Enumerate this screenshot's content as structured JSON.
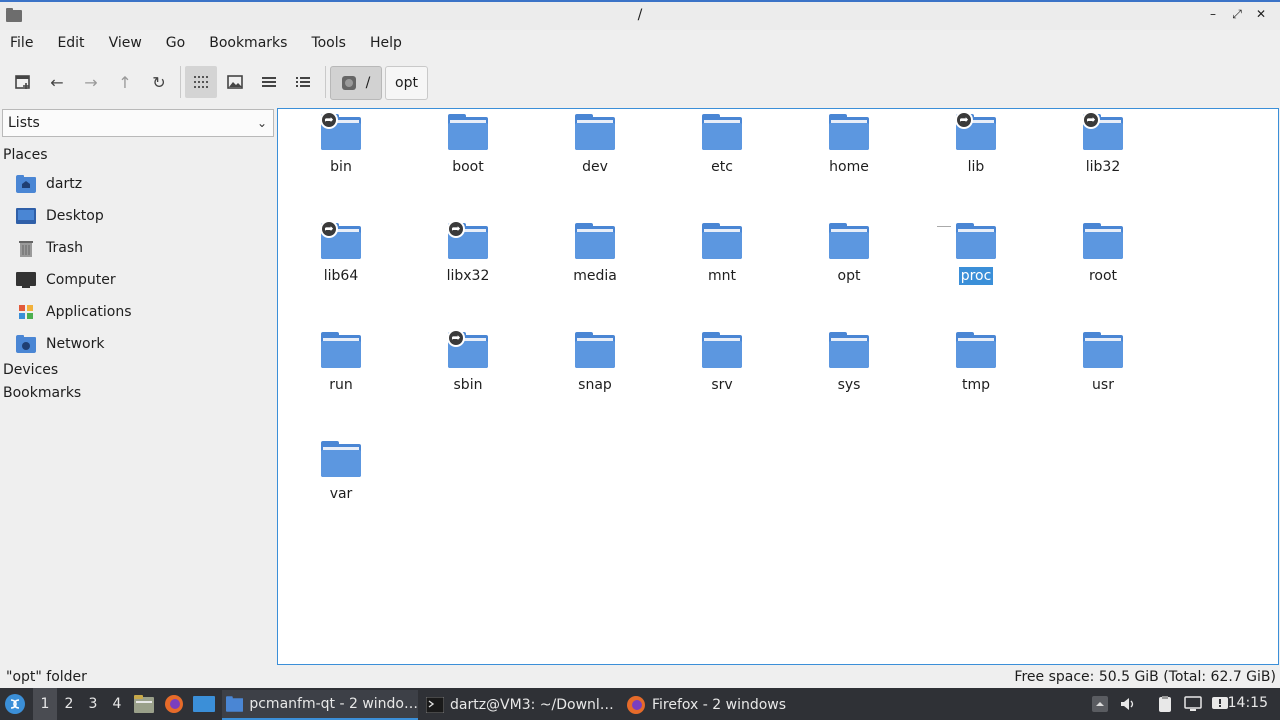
{
  "window": {
    "title": "/"
  },
  "menubar": [
    "File",
    "Edit",
    "View",
    "Go",
    "Bookmarks",
    "Tools",
    "Help"
  ],
  "path": {
    "root": "/",
    "segment": "opt"
  },
  "sidebar": {
    "dropdown": "Lists",
    "places_heading": "Places",
    "places": [
      {
        "label": "dartz",
        "icon": "home-folder-icon"
      },
      {
        "label": "Desktop",
        "icon": "desktop-icon"
      },
      {
        "label": "Trash",
        "icon": "trash-icon"
      },
      {
        "label": "Computer",
        "icon": "computer-icon"
      },
      {
        "label": "Applications",
        "icon": "applications-icon"
      },
      {
        "label": "Network",
        "icon": "network-icon"
      }
    ],
    "devices_heading": "Devices",
    "bookmarks_heading": "Bookmarks"
  },
  "files": [
    {
      "name": "bin",
      "link": true
    },
    {
      "name": "boot",
      "link": false
    },
    {
      "name": "dev",
      "link": false
    },
    {
      "name": "etc",
      "link": false
    },
    {
      "name": "home",
      "link": false
    },
    {
      "name": "lib",
      "link": true
    },
    {
      "name": "lib32",
      "link": true
    },
    {
      "name": "lib64",
      "link": true
    },
    {
      "name": "libx32",
      "link": true
    },
    {
      "name": "media",
      "link": false
    },
    {
      "name": "mnt",
      "link": false
    },
    {
      "name": "opt",
      "link": false
    },
    {
      "name": "proc",
      "link": false,
      "selected": true
    },
    {
      "name": "root",
      "link": false
    },
    {
      "name": "run",
      "link": false
    },
    {
      "name": "sbin",
      "link": true
    },
    {
      "name": "snap",
      "link": false
    },
    {
      "name": "srv",
      "link": false
    },
    {
      "name": "sys",
      "link": false
    },
    {
      "name": "tmp",
      "link": false
    },
    {
      "name": "usr",
      "link": false
    },
    {
      "name": "var",
      "link": false
    }
  ],
  "status": {
    "left": "\"opt\" folder",
    "right": "Free space: 50.5 GiB (Total: 62.7 GiB)"
  },
  "taskbar": {
    "workspaces": [
      "1",
      "2",
      "3",
      "4"
    ],
    "active_workspace": "1",
    "tasks": [
      {
        "label": "pcmanfm-qt - 2 windo…",
        "active": true
      },
      {
        "label": "dartz@VM3: ~/Downl…",
        "active": false
      },
      {
        "label": "Firefox - 2 windows",
        "active": false
      }
    ],
    "clock": "14:15"
  },
  "colors": {
    "accent": "#3b8fd8",
    "folder": "#5c97e0",
    "taskbar": "#2f3136"
  }
}
